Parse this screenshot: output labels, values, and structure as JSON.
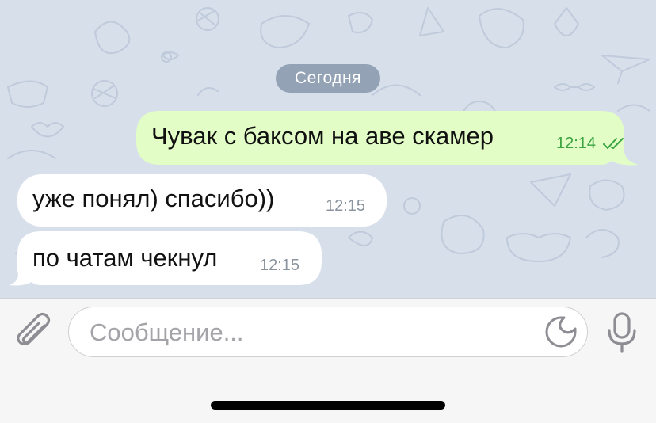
{
  "chat": {
    "date_separator": "Сегодня",
    "messages": [
      {
        "direction": "outgoing",
        "text": "Чувак с баксом на аве скамер",
        "time": "12:14",
        "status": "read"
      },
      {
        "direction": "incoming",
        "text": "уже понял) спасибо))",
        "time": "12:15"
      },
      {
        "direction": "incoming",
        "text": "по чатам чекнул",
        "time": "12:15"
      }
    ]
  },
  "composer": {
    "placeholder": "Сообщение...",
    "icons": {
      "attach": "paperclip-icon",
      "sticker": "sticker-icon",
      "voice": "microphone-icon"
    }
  },
  "colors": {
    "wallpaper": "#d7dfeb",
    "outgoing_bubble": "#e2fdc6",
    "incoming_bubble": "#ffffff",
    "outgoing_time": "#3aa540",
    "incoming_time": "#8a949e",
    "date_pill": "#7a8aa0"
  }
}
